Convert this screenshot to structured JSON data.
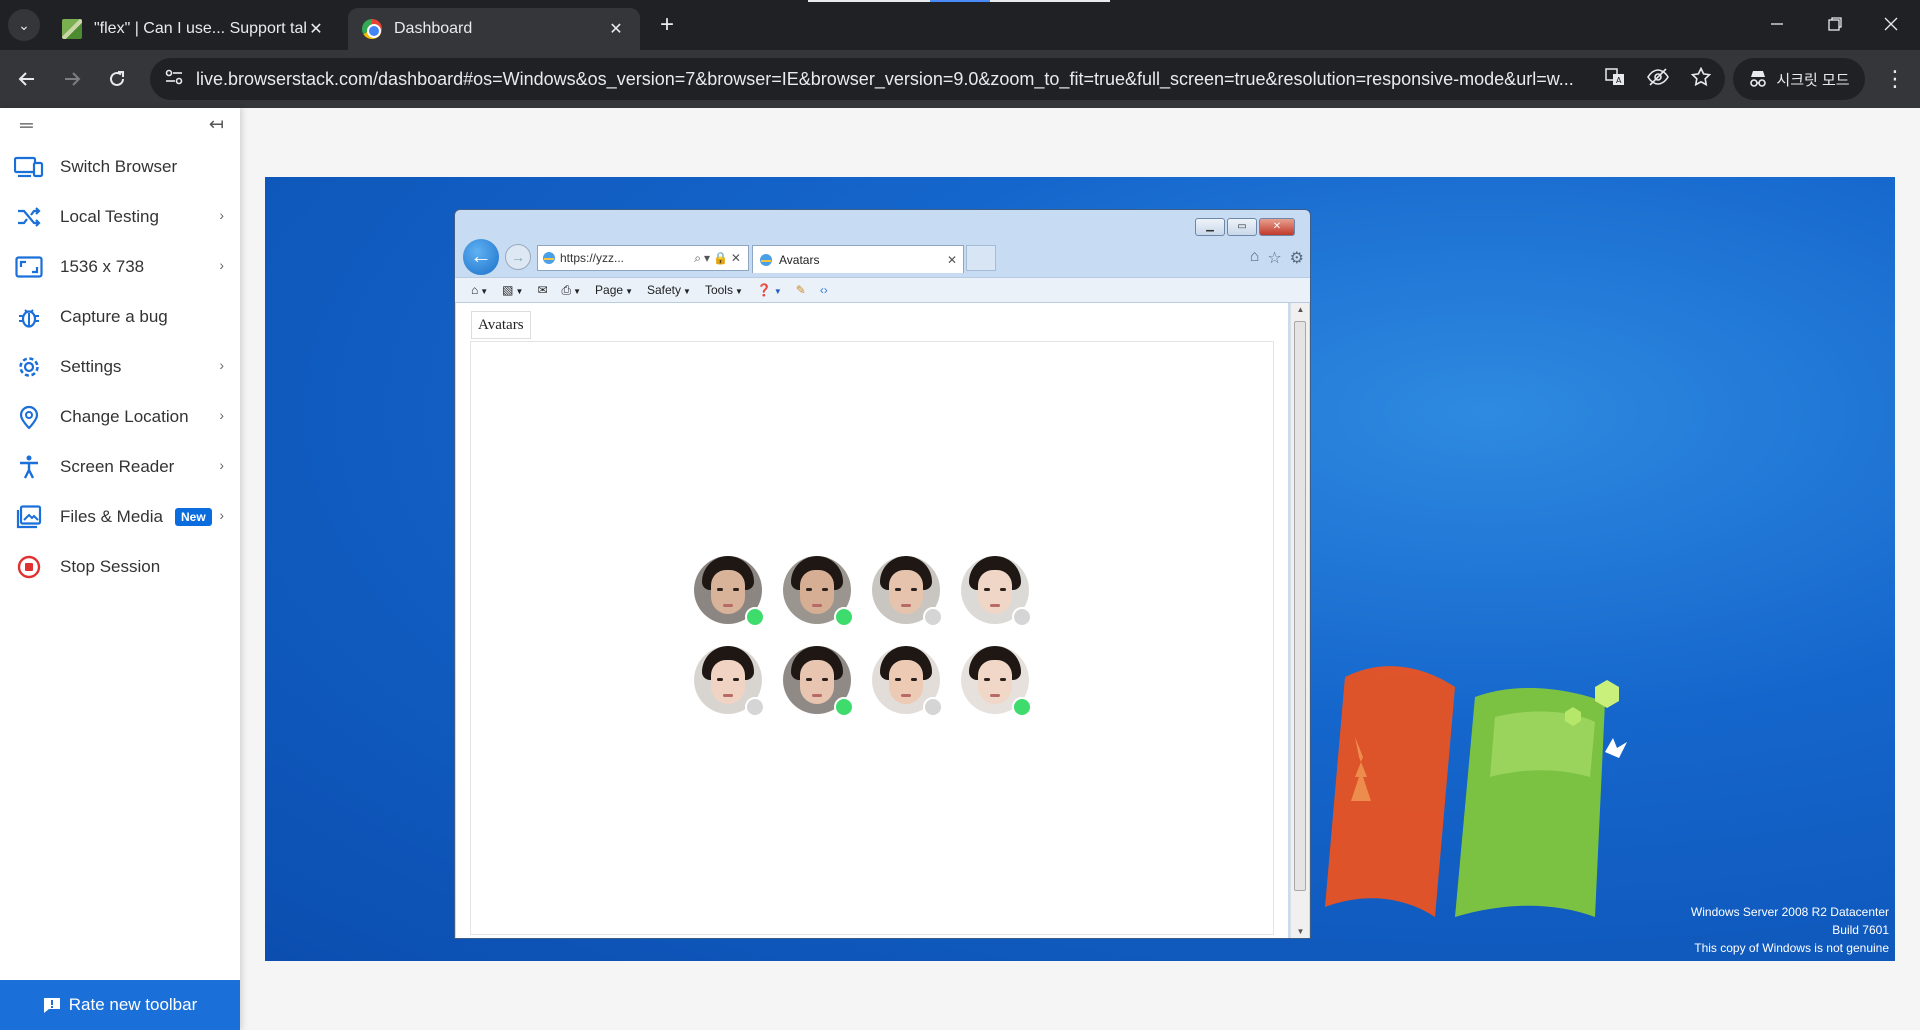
{
  "browser": {
    "tabs": [
      {
        "title": "\"flex\" | Can I use... Support tab",
        "active": false
      },
      {
        "title": "Dashboard",
        "active": true
      }
    ],
    "url": "live.browserstack.com/dashboard#os=Windows&os_version=7&browser=IE&browser_version=9.0&zoom_to_fit=true&full_screen=true&resolution=responsive-mode&url=w...",
    "incognito_label": "시크릿 모드"
  },
  "sidebar": {
    "items": [
      {
        "label": "Switch Browser",
        "icon": "monitor-devices-icon",
        "has_submenu": false
      },
      {
        "label": "Local Testing",
        "icon": "shuffle-icon",
        "has_submenu": true
      },
      {
        "label": "1536 x 738",
        "icon": "resize-icon",
        "has_submenu": true
      },
      {
        "label": "Capture a bug",
        "icon": "bug-icon",
        "has_submenu": false
      },
      {
        "label": "Settings",
        "icon": "gear-icon",
        "has_submenu": true
      },
      {
        "label": "Change Location",
        "icon": "location-pin-icon",
        "has_submenu": true
      },
      {
        "label": "Screen Reader",
        "icon": "accessibility-icon",
        "has_submenu": true
      },
      {
        "label": "Files & Media",
        "icon": "image-icon",
        "has_submenu": true,
        "badge": "New"
      },
      {
        "label": "Stop Session",
        "icon": "stop-icon",
        "has_submenu": false
      }
    ],
    "rate_button": "Rate new toolbar",
    "accent_color": "#1a6fd8"
  },
  "ie": {
    "address": "https://yzz...",
    "tab_title": "Avatars",
    "commands": [
      "Page",
      "Safety",
      "Tools"
    ],
    "page_title": "Avatars",
    "avatars": [
      {
        "status": "online",
        "skin": "#d9b29a",
        "bg": "#8b8682"
      },
      {
        "status": "online",
        "skin": "#d6ae94",
        "bg": "#9a958f"
      },
      {
        "status": "offline",
        "skin": "#e6c3ad",
        "bg": "#c9c6c2"
      },
      {
        "status": "offline",
        "skin": "#f0d6c6",
        "bg": "#dcdad6"
      },
      {
        "status": "offline",
        "skin": "#f0d3c3",
        "bg": "#d8d4cf"
      },
      {
        "status": "online",
        "skin": "#e8c5b0",
        "bg": "#8f8a86"
      },
      {
        "status": "offline",
        "skin": "#eccab4",
        "bg": "#e2ddd8"
      },
      {
        "status": "online",
        "skin": "#f1d7c7",
        "bg": "#e6e1dc"
      }
    ]
  },
  "desktop": {
    "watermark": [
      "Windows Server 2008 R2 Datacenter",
      "Build 7601",
      "This copy of Windows is not genuine"
    ]
  }
}
